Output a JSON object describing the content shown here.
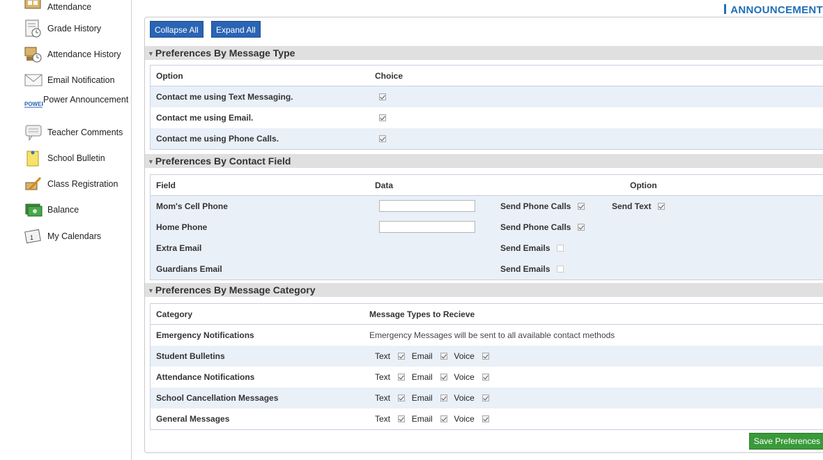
{
  "sidebar": {
    "items": [
      {
        "label": "Attendance",
        "icon": "attendance-icon"
      },
      {
        "label": "Grade History",
        "icon": "grade-history-icon"
      },
      {
        "label": "Attendance History",
        "icon": "attendance-history-icon"
      },
      {
        "label": "Email Notification",
        "icon": "email-icon"
      },
      {
        "label": "Power Announcement",
        "icon": "power-announcement-icon",
        "icon_text": "POWER"
      },
      {
        "label": "Teacher Comments",
        "icon": "comments-icon"
      },
      {
        "label": "School Bulletin",
        "icon": "bulletin-icon"
      },
      {
        "label": "Class Registration",
        "icon": "registration-icon"
      },
      {
        "label": "Balance",
        "icon": "balance-icon"
      },
      {
        "label": "My Calendars",
        "icon": "calendar-icon"
      }
    ]
  },
  "header": {
    "title": "ANNOUNCEMENT"
  },
  "toolbar": {
    "collapse_label": "Collapse All",
    "expand_label": "Expand All"
  },
  "message_type": {
    "title": "Preferences By Message Type",
    "col_option": "Option",
    "col_choice": "Choice",
    "rows": [
      {
        "option": "Contact me using Text Messaging.",
        "checked": true
      },
      {
        "option": "Contact me using Email.",
        "checked": true
      },
      {
        "option": "Contact me using Phone Calls.",
        "checked": true
      }
    ]
  },
  "contact_field": {
    "title": "Preferences By Contact Field",
    "col_field": "Field",
    "col_data": "Data",
    "col_option": "Option",
    "rows": [
      {
        "field": "Mom's Cell Phone",
        "has_input": true,
        "value": "",
        "opt1": "Send Phone Calls",
        "opt1_checked": true,
        "opt2": "Send Text",
        "opt2_checked": true
      },
      {
        "field": "Home Phone",
        "has_input": true,
        "value": "",
        "opt1": "Send Phone Calls",
        "opt1_checked": true
      },
      {
        "field": "Extra Email",
        "has_input": false,
        "opt1": "Send Emails",
        "opt1_checked": false
      },
      {
        "field": "Guardians Email",
        "has_input": false,
        "opt1": "Send Emails",
        "opt1_checked": false
      }
    ]
  },
  "message_category": {
    "title": "Preferences By Message Category",
    "col_category": "Category",
    "col_types": "Message Types to Recieve",
    "emergency": {
      "category": "Emergency Notifications",
      "note": "Emergency Messages will be sent to all available contact methods"
    },
    "type_labels": {
      "text": "Text",
      "email": "Email",
      "voice": "Voice"
    },
    "rows": [
      {
        "category": "Student Bulletins",
        "text": true,
        "email": true,
        "voice": true
      },
      {
        "category": "Attendance Notifications",
        "text": true,
        "email": true,
        "voice": true
      },
      {
        "category": "School Cancellation Messages",
        "text": true,
        "email": true,
        "voice": true
      },
      {
        "category": "General Messages",
        "text": true,
        "email": true,
        "voice": true
      }
    ]
  },
  "footer": {
    "save_label": "Save Preferences"
  },
  "colors": {
    "accent_blue": "#2a64b4",
    "title_blue": "#1e6fb8",
    "save_green": "#3a9a3a",
    "row_alt": "#eaf0f8"
  }
}
